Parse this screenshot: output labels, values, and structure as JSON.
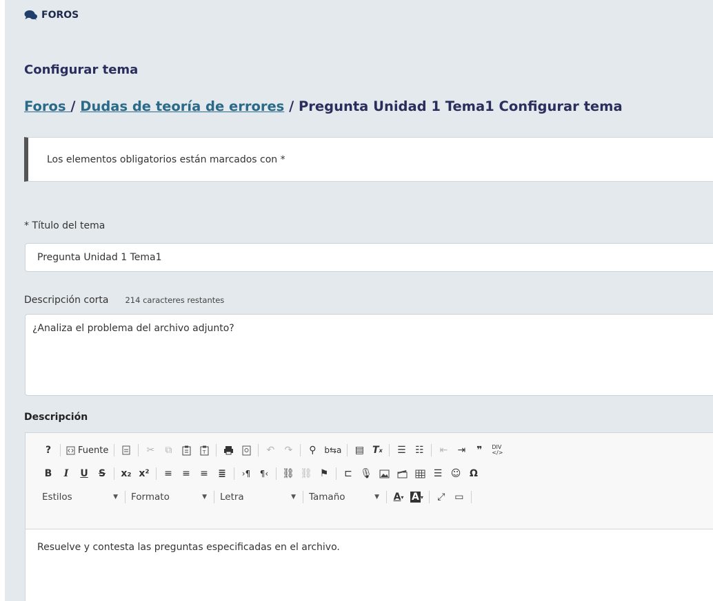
{
  "section": {
    "icon": "comments-icon",
    "title": "FOROS"
  },
  "page_title": "Configurar tema",
  "breadcrumb": {
    "link1": "Foros ",
    "sep1": " / ",
    "link2": "Dudas de teoría de errores",
    "rest": " / Pregunta Unidad 1 Tema1 Configurar tema"
  },
  "notice": "Los elementos obligatorios están marcados con *",
  "title_field": {
    "label": "* Título del tema",
    "value": "Pregunta Unidad 1 Tema1"
  },
  "short_desc": {
    "label": "Descripción corta",
    "hint": "214 caracteres restantes",
    "value": "¿Analiza el problema del archivo adjunto?"
  },
  "description": {
    "label": "Descripción",
    "body": "Resuelve y contesta las preguntas especificadas en el archivo."
  },
  "toolbar": {
    "help": "?",
    "source_label": "Fuente",
    "bold": "B",
    "italic": "I",
    "underline": "U",
    "strike": "S",
    "subscript": "x₂",
    "superscript": "x²",
    "special_char": "Ω",
    "styles": "Estilos",
    "format": "Formato",
    "font": "Letra",
    "size": "Tamaño"
  },
  "colors": {
    "background": "#e3e9ed",
    "heading": "#2b2e5c",
    "link": "#2a6a88"
  }
}
